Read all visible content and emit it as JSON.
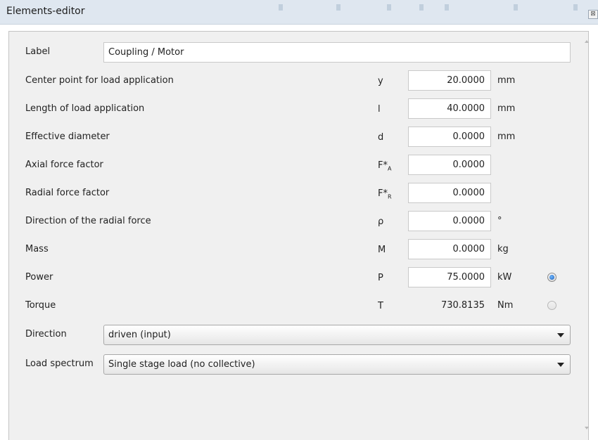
{
  "window": {
    "title": "Elements-editor",
    "close_glyph": "⊠"
  },
  "label_field": {
    "label": "Label",
    "value": "Coupling / Motor"
  },
  "params": [
    {
      "label": "Center point for load application",
      "symbol": "y",
      "sub": "",
      "value": "20.0000",
      "unit": "mm"
    },
    {
      "label": "Length of load application",
      "symbol": "l",
      "sub": "",
      "value": "40.0000",
      "unit": "mm"
    },
    {
      "label": "Effective diameter",
      "symbol": "d",
      "sub": "",
      "value": "0.0000",
      "unit": "mm"
    },
    {
      "label": "Axial force factor",
      "symbol": "F*",
      "sub": "A",
      "value": "0.0000",
      "unit": ""
    },
    {
      "label": "Radial force factor",
      "symbol": "F*",
      "sub": "R",
      "value": "0.0000",
      "unit": ""
    },
    {
      "label": "Direction of the radial force",
      "symbol": "ρ",
      "sub": "",
      "value": "0.0000",
      "unit": "°"
    },
    {
      "label": "Mass",
      "symbol": "M",
      "sub": "",
      "value": "0.0000",
      "unit": "kg"
    },
    {
      "label": "Power",
      "symbol": "P",
      "sub": "",
      "value": "75.0000",
      "unit": "kW",
      "selected": true
    },
    {
      "label": "Torque",
      "symbol": "T",
      "sub": "",
      "value": "730.8135",
      "unit": "Nm",
      "selected": false
    }
  ],
  "direction": {
    "label": "Direction",
    "value": "driven (input)"
  },
  "load_spectrum": {
    "label": "Load spectrum",
    "value": "Single stage load (no collective)"
  },
  "icons": {
    "close": "close-icon",
    "dropdown": "chevron-down-icon",
    "radio": "radio-button"
  }
}
